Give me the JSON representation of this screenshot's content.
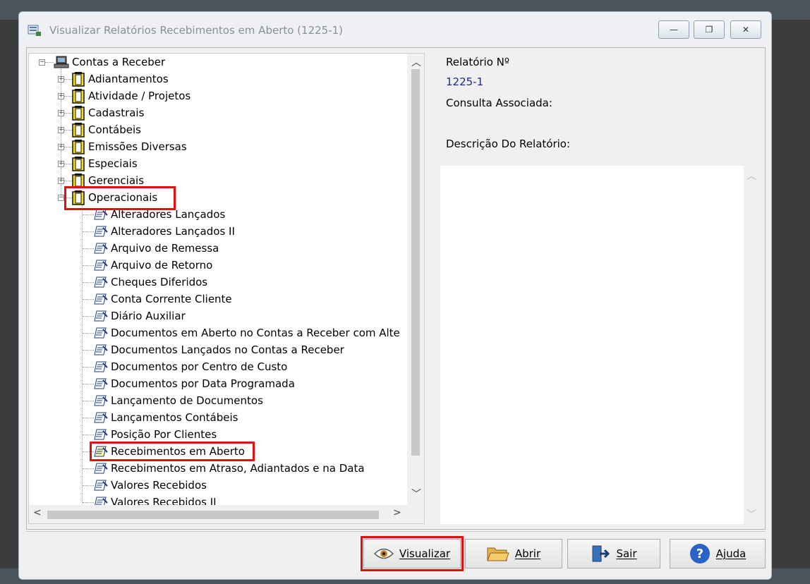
{
  "window": {
    "title": "Visualizar Relatórios Recebimentos em Aberto (1225-1)",
    "controls": {
      "minimize": "—",
      "restore": "❐",
      "close": "✕"
    }
  },
  "tree": {
    "root": {
      "label": "Contas a Receber",
      "icon": "computer-icon"
    },
    "folders": [
      {
        "label": "Adiantamentos",
        "expanded": false
      },
      {
        "label": "Atividade / Projetos",
        "expanded": false
      },
      {
        "label": "Cadastrais",
        "expanded": false
      },
      {
        "label": "Contábeis",
        "expanded": false
      },
      {
        "label": "Emissões Diversas",
        "expanded": false
      },
      {
        "label": "Especiais",
        "expanded": false
      },
      {
        "label": "Gerenciais",
        "expanded": false
      },
      {
        "label": "Operacionais",
        "expanded": true
      }
    ],
    "reports": [
      {
        "label": "Alteradores  Lançados"
      },
      {
        "label": "Alteradores  Lançados II"
      },
      {
        "label": "Arquivo de Remessa"
      },
      {
        "label": "Arquivo de Retorno"
      },
      {
        "label": "Cheques Diferidos"
      },
      {
        "label": "Conta Corrente Cliente"
      },
      {
        "label": "Diário  Auxiliar"
      },
      {
        "label": "Documentos em Aberto no Contas a Receber com Alte"
      },
      {
        "label": "Documentos Lançados no Contas a Receber"
      },
      {
        "label": "Documentos por Centro de Custo"
      },
      {
        "label": "Documentos por Data Programada"
      },
      {
        "label": "Lançamento  de Documentos"
      },
      {
        "label": "Lançamentos Contábeis"
      },
      {
        "label": "Posição Por Clientes"
      },
      {
        "label": "Recebimentos em Aberto",
        "selected": true
      },
      {
        "label": "Recebimentos em Atraso, Adiantados e na Data"
      },
      {
        "label": "Valores Recebidos"
      },
      {
        "label": "Valores Recebidos II"
      }
    ]
  },
  "details": {
    "report_number_label": "Relatório Nº",
    "report_number_value": "1225-1",
    "associated_query_label": "Consulta Associada:",
    "description_label": "Descrição Do Relatório:"
  },
  "buttons": {
    "view": "Visualizar",
    "open": "Abrir",
    "exit": "Sair",
    "help": "Ajuda"
  },
  "colors": {
    "highlight": "#e01010",
    "value_text": "#1a2a8a",
    "folder_yellow": "#f4e21a"
  }
}
